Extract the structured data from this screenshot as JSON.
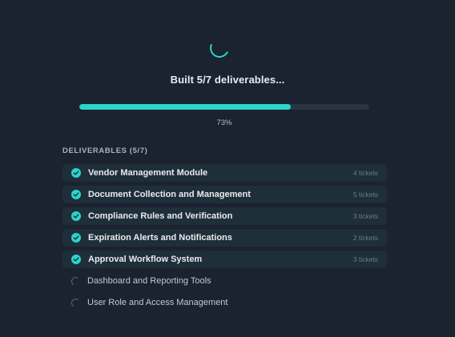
{
  "status": {
    "title": "Built 5/7 deliverables...",
    "progress_fraction": 0.73,
    "progress_text": "73%"
  },
  "deliverables": {
    "header": "DELIVERABLES (5/7)",
    "items": [
      {
        "label": "Vendor Management Module",
        "count": "4 tickets",
        "state": "done"
      },
      {
        "label": "Document Collection and Management",
        "count": "5 tickets",
        "state": "done"
      },
      {
        "label": "Compliance Rules and Verification",
        "count": "3 tickets",
        "state": "done"
      },
      {
        "label": "Expiration Alerts and Notifications",
        "count": "2 tickets",
        "state": "done"
      },
      {
        "label": "Approval Workflow System",
        "count": "3 tickets",
        "state": "done"
      },
      {
        "label": "Dashboard and Reporting Tools",
        "count": "",
        "state": "pending"
      },
      {
        "label": "User Role and Access Management",
        "count": "",
        "state": "pending"
      }
    ]
  },
  "colors": {
    "background": "#1b2230",
    "accent": "#2dd4cb",
    "done_row": "#1f2f3a"
  },
  "icons": {
    "spinner": "loading-spinner-icon",
    "done": "check-circle-icon",
    "pending": "pending-spinner-icon"
  }
}
